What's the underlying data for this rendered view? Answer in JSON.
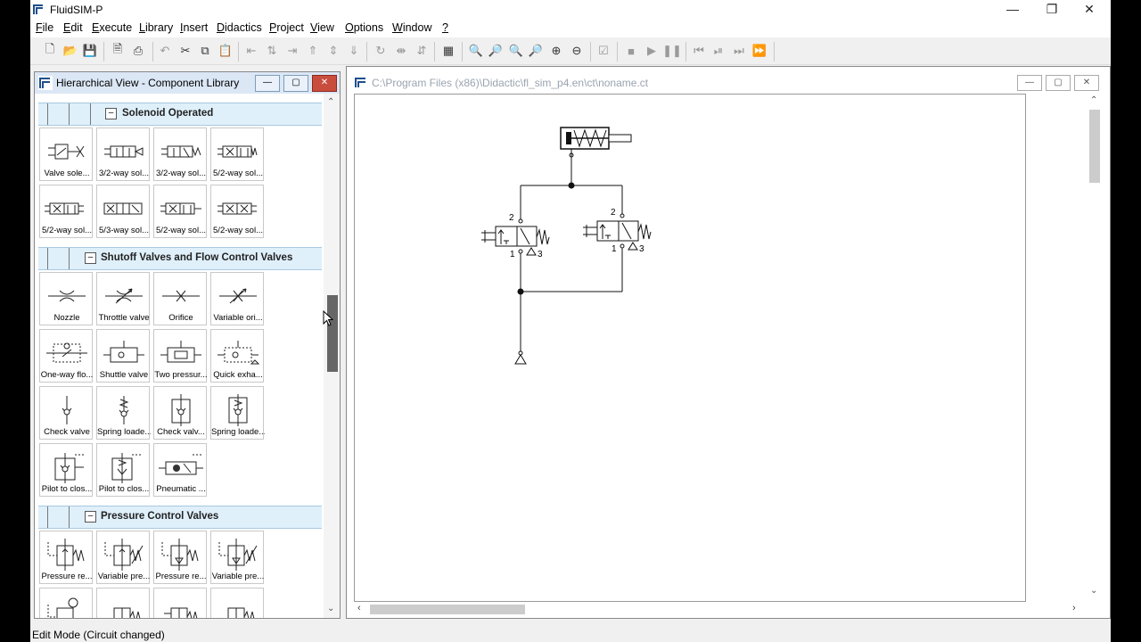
{
  "app": {
    "title": "FluidSIM-P"
  },
  "menu": [
    {
      "label": "File",
      "u": "F",
      "rest": "ile"
    },
    {
      "label": "Edit",
      "u": "E",
      "rest": "dit"
    },
    {
      "label": "Execute",
      "u": "E",
      "rest": "xecute"
    },
    {
      "label": "Library",
      "u": "L",
      "rest": "ibrary"
    },
    {
      "label": "Insert",
      "u": "I",
      "rest": "nsert"
    },
    {
      "label": "Didactics",
      "u": "D",
      "rest": "idactics"
    },
    {
      "label": "Project",
      "u": "P",
      "rest": "roject"
    },
    {
      "label": "View",
      "u": "V",
      "rest": "iew"
    },
    {
      "label": "Options",
      "u": "O",
      "rest": "ptions"
    },
    {
      "label": "Window",
      "u": "W",
      "rest": "indow"
    },
    {
      "label": "?",
      "u": "?",
      "rest": ""
    }
  ],
  "library": {
    "title": "Hierarchical View - Component Library",
    "groups": [
      {
        "label": "Solenoid Operated",
        "tiles": [
          "Valve sole...",
          "3/2-way sol...",
          "3/2-way sol...",
          "5/2-way sol...",
          "5/2-way sol...",
          "5/3-way sol...",
          "5/2-way sol...",
          "5/2-way sol..."
        ]
      },
      {
        "label": "Shutoff Valves and Flow Control Valves",
        "tiles": [
          "Nozzle",
          "Throttle valve",
          "Orifice",
          "Variable ori...",
          "One-way flo...",
          "Shuttle valve",
          "Two pressur...",
          "Quick exha...",
          "Check valve",
          "Spring loade...",
          "Check valv...",
          "Spring loade...",
          "Pilot to clos...",
          "Pilot to clos...",
          "Pneumatic ..."
        ]
      },
      {
        "label": "Pressure Control Valves",
        "tiles": [
          "Pressure re...",
          "Variable pre...",
          "Pressure re...",
          "Variable pre..."
        ]
      }
    ]
  },
  "circuit": {
    "path": "C:\\Program Files (x86)\\Didactic\\fl_sim_p4.en\\ct\\noname.ct",
    "port_labels": {
      "left_top": "2",
      "left_bottom": "1",
      "left_exhaust": "3",
      "right_top": "2",
      "right_bottom": "1",
      "right_exhaust": "3"
    }
  },
  "status": {
    "text": "Edit Mode (Circuit changed)"
  }
}
